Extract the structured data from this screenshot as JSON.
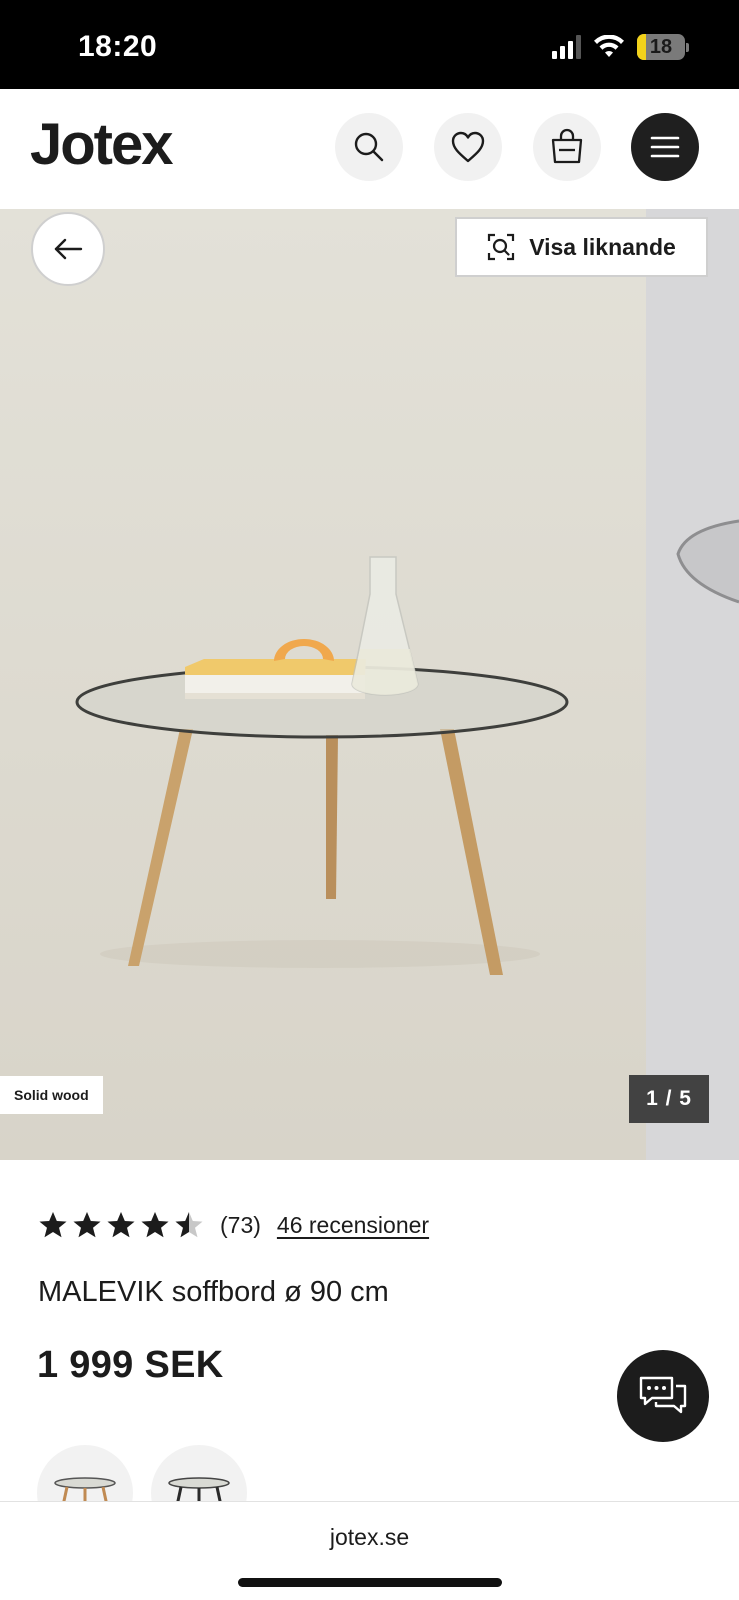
{
  "status_bar": {
    "time": "18:20",
    "battery": "18",
    "battery_fraction": 0.18
  },
  "header": {
    "logo": "Jotex",
    "icons": [
      "search-icon",
      "heart-icon",
      "shopping-bag-icon",
      "menu-icon"
    ]
  },
  "gallery": {
    "visa_liknande": "Visa liknande",
    "badge": "Solid wood",
    "counter": "1 / 5",
    "current_image": 1,
    "total_images": 5
  },
  "product": {
    "rating": 4.5,
    "rating_count": "(73)",
    "reviews_link": "46 recensioner",
    "title": "MALEVIK soffbord ø 90 cm",
    "price": "1 999 SEK",
    "variants": [
      "oak-legs",
      "black-legs"
    ]
  },
  "browser": {
    "url": "jotex.se"
  },
  "colors": {
    "status_bar": "#000000",
    "dark_button": "#1f1f1f",
    "counter_bg": "#424242",
    "battery_accent": "#f2d21b"
  }
}
